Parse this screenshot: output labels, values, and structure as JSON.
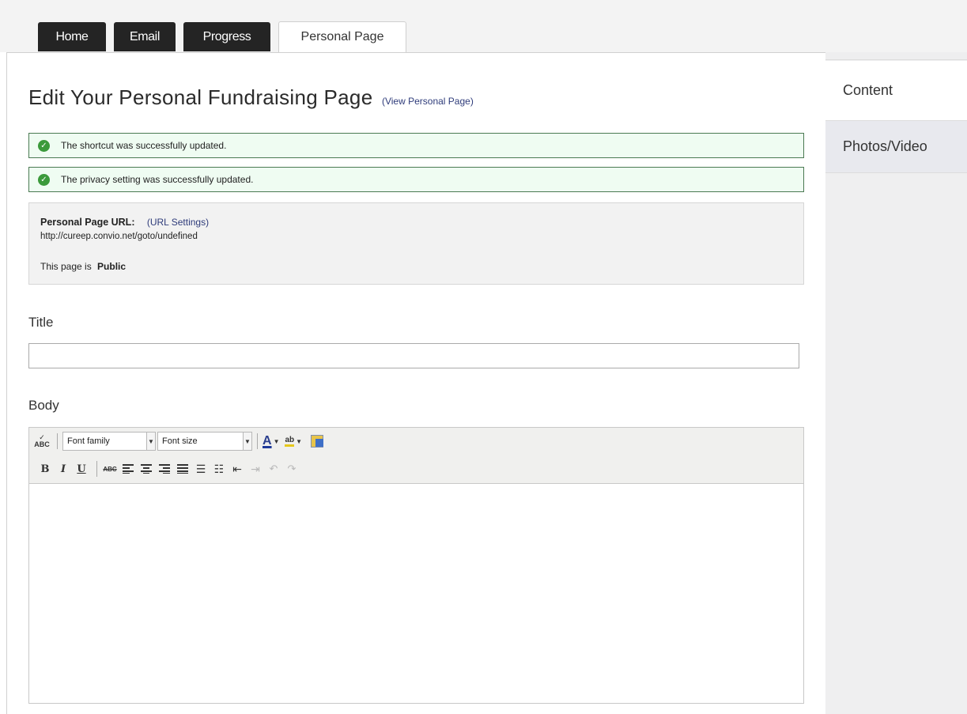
{
  "tabs": [
    {
      "label": "Home"
    },
    {
      "label": "Email"
    },
    {
      "label": "Progress"
    },
    {
      "label": "Personal Page",
      "active": true
    }
  ],
  "page": {
    "title": "Edit Your Personal Fundraising Page",
    "view_link": "(View Personal Page)"
  },
  "messages": [
    "The shortcut was successfully updated.",
    "The privacy setting was successfully updated."
  ],
  "url_box": {
    "url_label": "Personal Page URL:",
    "url_settings_link": "(URL Settings)",
    "url": "http://cureep.convio.net/goto/undefined",
    "privacy_prefix": "This page is",
    "privacy_value": "Public"
  },
  "form": {
    "title_label": "Title",
    "title_value": "",
    "body_label": "Body"
  },
  "editor": {
    "font_family_label": "Font family",
    "font_size_label": "Font size",
    "spellcheck_text": "ABC",
    "bold": "B",
    "italic": "I",
    "underline": "U",
    "strikethrough": "ABC",
    "font_color": "A",
    "highlight": "ab"
  },
  "sidebar": {
    "items": [
      {
        "label": "Content",
        "active": true
      },
      {
        "label": "Photos/Video"
      }
    ]
  },
  "colors": {
    "tab_bg": "#242424",
    "success_border": "#4a7a52",
    "success_bg": "#effcf2",
    "link": "#2e3b7a"
  }
}
